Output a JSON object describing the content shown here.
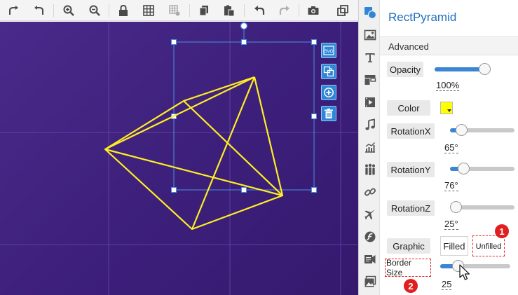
{
  "toolbar": {
    "icons": [
      "redo-arrow-icon",
      "undo-arrow-icon",
      "zoom-in-icon",
      "zoom-out-icon",
      "lock-icon",
      "grid-icon",
      "grid-settings-icon",
      "copy-icon",
      "paste-icon",
      "undo-icon",
      "redo-icon",
      "camera-icon",
      "resize-icon"
    ]
  },
  "canvas": {
    "background": "#3e2180",
    "shape_color": "#ffee22",
    "side_tools": [
      "svg-icon",
      "replace-icon",
      "add-icon",
      "delete-icon"
    ]
  },
  "sidebar": {
    "icons": [
      "shapes-icon",
      "image-icon",
      "text-icon",
      "layout-icon",
      "video-icon",
      "music-icon",
      "chart-icon",
      "people-icon",
      "link-icon",
      "plane-icon",
      "flash-icon",
      "sound-icon",
      "gallery-icon"
    ]
  },
  "panel": {
    "title": "RectPyramid",
    "section": "Advanced",
    "opacity": {
      "label": "Opacity",
      "value": "100%",
      "level": 1.0
    },
    "color": {
      "label": "Color",
      "value": "#ffff00"
    },
    "rotation_x": {
      "label": "RotationX",
      "value": "65°",
      "level": 0.18
    },
    "rotation_y": {
      "label": "RotationY",
      "value": "76°",
      "level": 0.21
    },
    "rotation_z": {
      "label": "RotationZ",
      "value": "25°",
      "level": 0.07
    },
    "graphic": {
      "label": "Graphic",
      "options": [
        "Filled",
        "Unfilled"
      ],
      "selected": "Unfilled"
    },
    "border_size": {
      "label": "Border Size",
      "value": "25",
      "level": 0.25
    },
    "badges": [
      "1",
      "2"
    ],
    "accent": "#1f6fbf",
    "highlight": "#e02424"
  }
}
